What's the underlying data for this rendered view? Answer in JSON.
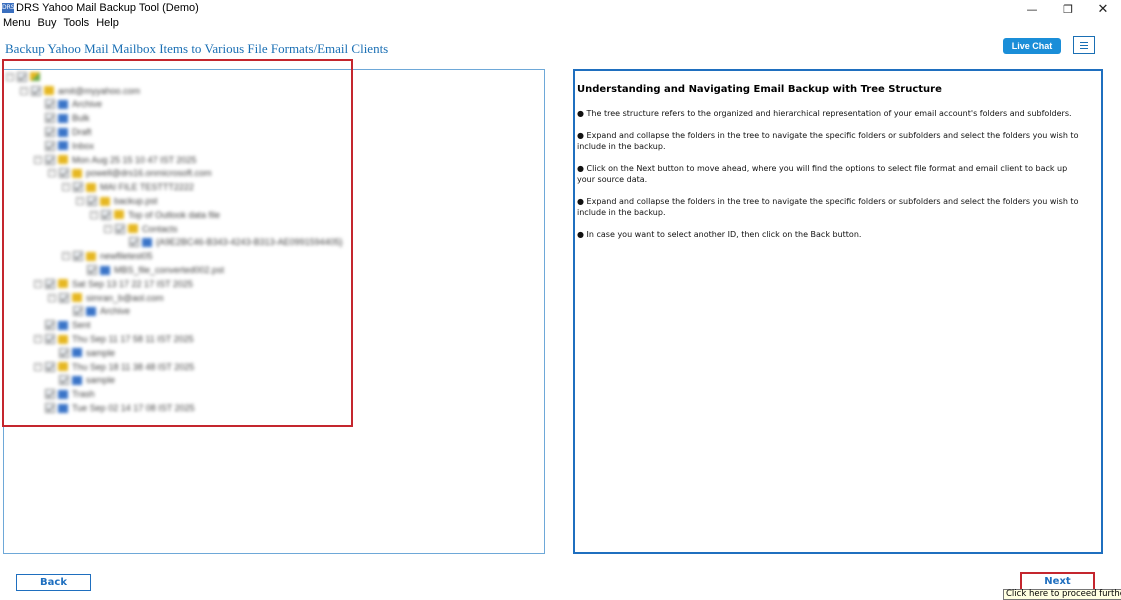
{
  "window": {
    "title": "DRS Yahoo Mail Backup Tool (Demo)",
    "icon_text": "DRS",
    "controls": {
      "minimize": "—",
      "maximize": "❐",
      "close": "✕"
    }
  },
  "menu": [
    "Menu",
    "Buy",
    "Tools",
    "Help"
  ],
  "header": {
    "title": "Backup Yahoo Mail Mailbox Items to Various File Formats/Email Clients",
    "live_chat": "Live Chat"
  },
  "tree": [
    {
      "label": "",
      "indent": 0,
      "icon": "mixed",
      "exp": "−",
      "selected": true
    },
    {
      "label": "amit@myyahoo.com",
      "indent": 1,
      "icon": "folder",
      "exp": "−"
    },
    {
      "label": "Archive",
      "indent": 2,
      "icon": "mail",
      "exp": ""
    },
    {
      "label": "Bulk",
      "indent": 2,
      "icon": "mail",
      "exp": ""
    },
    {
      "label": "Draft",
      "indent": 2,
      "icon": "mail",
      "exp": ""
    },
    {
      "label": "Inbox",
      "indent": 2,
      "icon": "mail",
      "exp": ""
    },
    {
      "label": "Mon Aug 25 15 10 47 IST 2025",
      "indent": 2,
      "icon": "folder",
      "exp": "−"
    },
    {
      "label": "powell@drs16.onmicrosoft.com",
      "indent": 3,
      "icon": "folder",
      "exp": "−"
    },
    {
      "label": "MAI FILE TESTTT2222",
      "indent": 4,
      "icon": "folder",
      "exp": "−"
    },
    {
      "label": "backup.pst",
      "indent": 5,
      "icon": "folder",
      "exp": "−"
    },
    {
      "label": "Top of Outlook data file",
      "indent": 6,
      "icon": "folder",
      "exp": "−"
    },
    {
      "label": "Contacts",
      "indent": 7,
      "icon": "folder",
      "exp": "−"
    },
    {
      "label": "{A9E2BC46-B343-4243-B313-AE0991594405}",
      "indent": 8,
      "icon": "mail",
      "exp": ""
    },
    {
      "label": "newfiletest05",
      "indent": 4,
      "icon": "folder",
      "exp": "−"
    },
    {
      "label": "MBS_file_converted002.pst",
      "indent": 5,
      "icon": "mail",
      "exp": ""
    },
    {
      "label": "Sat Sep 13 17 22 17 IST 2025",
      "indent": 2,
      "icon": "folder",
      "exp": "−"
    },
    {
      "label": "simran_b@aol.com",
      "indent": 3,
      "icon": "folder",
      "exp": "−"
    },
    {
      "label": "Archive",
      "indent": 4,
      "icon": "mail",
      "exp": ""
    },
    {
      "label": "Sent",
      "indent": 2,
      "icon": "mail",
      "exp": ""
    },
    {
      "label": "Thu Sep 11 17 58 11 IST 2025",
      "indent": 2,
      "icon": "folder",
      "exp": "−"
    },
    {
      "label": "sample",
      "indent": 3,
      "icon": "mail",
      "exp": ""
    },
    {
      "label": "Thu Sep 18 11 38 48 IST 2025",
      "indent": 2,
      "icon": "folder",
      "exp": "−"
    },
    {
      "label": "sample",
      "indent": 3,
      "icon": "mail",
      "exp": ""
    },
    {
      "label": "Trash",
      "indent": 2,
      "icon": "mail",
      "exp": ""
    },
    {
      "label": "Tue Sep 02 14 17 08 IST 2025",
      "indent": 2,
      "icon": "mail",
      "exp": ""
    }
  ],
  "info": {
    "title": "Understanding and Navigating Email Backup with Tree Structure",
    "points": [
      "The tree structure refers to the organized and hierarchical representation of your email account's folders and subfolders.",
      "Expand and collapse the folders in the tree to navigate the specific folders or subfolders and select the folders you wish to include in the backup.",
      "Click on the Next button to move ahead, where you will find the options to select file format and email client to back up your source data.",
      "Expand and collapse the folders in the tree to navigate the specific folders or subfolders and select the folders you wish to include in the backup.",
      "In case you want to select another ID, then click on the Back button."
    ]
  },
  "footer": {
    "back": "Back",
    "next": "Next",
    "next_tooltip": "Click here to proceed further."
  },
  "colors": {
    "accent": "#1a6fb4",
    "highlight_red": "#c4262e",
    "live_chat_bg": "#1a8ed8"
  }
}
